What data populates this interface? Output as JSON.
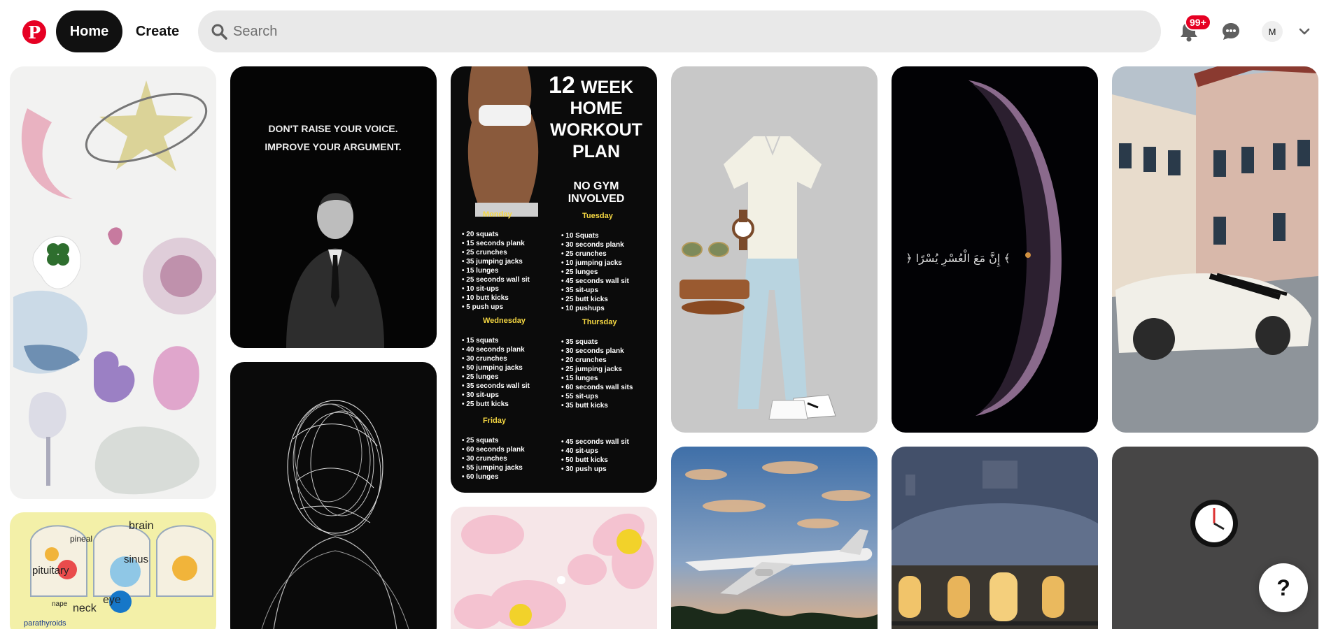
{
  "nav": {
    "logo": "P",
    "home_label": "Home",
    "create_label": "Create"
  },
  "search": {
    "placeholder": "Search",
    "icon": "search-icon"
  },
  "header_actions": {
    "notifications_badge": "99+",
    "avatar_initial": "M",
    "icons": [
      "bell-icon",
      "chat-bubble-icon",
      "chevron-down-icon"
    ]
  },
  "pins": [
    {
      "id": "glass-shapes",
      "text": ""
    },
    {
      "id": "quote",
      "text_line1": "DON'T RAISE YOUR VOICE.",
      "text_line2": "IMPROVE YOUR ARGUMENT."
    },
    {
      "id": "workout",
      "title_num": "12",
      "title_word": "WEEK",
      "title_l2": "HOME",
      "title_l3": "WORKOUT",
      "title_l4": "PLAN",
      "subtitle_l1": "NO GYM",
      "subtitle_l2": "INVOLVED",
      "days": [
        {
          "name": "Monday",
          "items": [
            "20 squats",
            "15 seconds plank",
            "25 crunches",
            "35 jumping jacks",
            "15 lunges",
            "25 seconds wall sit",
            "10 sit-ups",
            "10 butt kicks",
            "5 push ups"
          ]
        },
        {
          "name": "Tuesday",
          "items": [
            "10 Squats",
            "30 seconds plank",
            "25 crunches",
            "10 jumping jacks",
            "25 lunges",
            "45 seconds wall sit",
            "35 sit-ups",
            "25 butt kicks",
            "10 pushups"
          ]
        },
        {
          "name": "Wednesday",
          "items": [
            "15 squats",
            "40 seconds plank",
            "30 crunches",
            "50 jumping jacks",
            "25 lunges",
            "35 seconds wall sit",
            "30 sit-ups",
            "25 butt kicks"
          ]
        },
        {
          "name": "Thursday",
          "items": [
            "35 squats",
            "30 seconds plank",
            "20 crunches",
            "25 jumping jacks",
            "15 lunges",
            "60 seconds wall sits",
            "55 sit-ups",
            "35 butt kicks"
          ]
        },
        {
          "name": "Friday",
          "items": [
            "25 squats",
            "60 seconds plank",
            "30 crunches",
            "55 jumping jacks",
            "60 lunges"
          ]
        },
        {
          "name": "",
          "items": [
            "45 seconds wall sit",
            "40 sit-ups",
            "50 butt kicks",
            "30 push ups"
          ]
        }
      ]
    },
    {
      "id": "outfit"
    },
    {
      "id": "crescent",
      "text": "﴿ إِنَّ مَعَ الْعُسْرِ يُسْرًا ﴾"
    },
    {
      "id": "car"
    },
    {
      "id": "brain",
      "labels": [
        "brain",
        "pineal",
        "pituitary",
        "sinus",
        "eye",
        "nape",
        "neck",
        "parathyroids"
      ]
    },
    {
      "id": "wire-head"
    },
    {
      "id": "flowers"
    },
    {
      "id": "plane"
    },
    {
      "id": "building"
    },
    {
      "id": "clock"
    }
  ],
  "help_label": "?",
  "colors": {
    "brand": "#e60023",
    "nav_active": "#111111",
    "search_bg": "#e9e9e9"
  }
}
